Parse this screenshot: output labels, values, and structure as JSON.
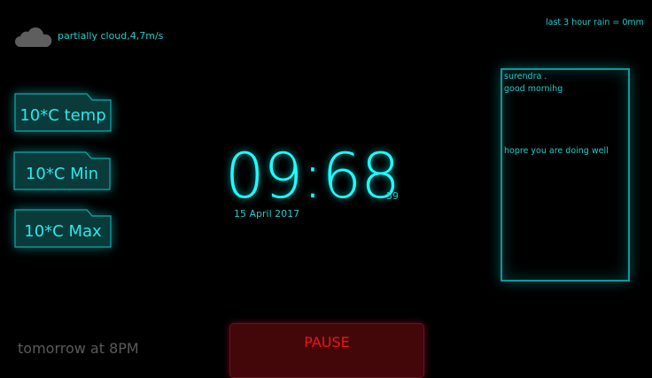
{
  "weather": {
    "icon": "cloud-icon",
    "description": "partially cloud,4,7m/s",
    "rain": "last 3 hour rain = 0mm"
  },
  "temps": [
    {
      "label": "10*C temp"
    },
    {
      "label": "10*C Min"
    },
    {
      "label": "10*C Max"
    }
  ],
  "clock": {
    "time": "09:68",
    "seconds": "59",
    "date": "15 April 2017"
  },
  "message": {
    "lines": [
      "surendra .",
      "good mornihg",
      "hopre you are doing well"
    ]
  },
  "footer": {
    "schedule": "tomorrow at 8PM",
    "pause_label": "PAUSE"
  },
  "colors": {
    "accent": "#1ffcfc",
    "panel": "#0a3a3a",
    "pause_bg": "#430709",
    "pause_text": "#ee1515"
  }
}
